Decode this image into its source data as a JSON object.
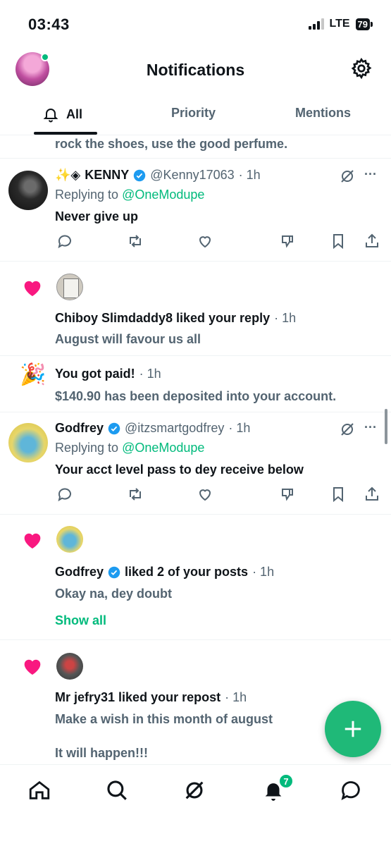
{
  "status_bar": {
    "time": "03:43",
    "network": "LTE",
    "battery": "79"
  },
  "header": {
    "title": "Notifications"
  },
  "tabs": [
    {
      "label": "All"
    },
    {
      "label": "Priority"
    },
    {
      "label": "Mentions"
    }
  ],
  "feed": {
    "truncated_text": "rock the shoes, use the good perfume.",
    "kenny": {
      "prefix": "✨◈",
      "name": "KENNY",
      "handle": "@Kenny17063",
      "time": "· 1h",
      "replying_label": "Replying to",
      "replying_handle": "@OneModupe",
      "text": "Never give up"
    },
    "chiboy": {
      "text": "Chiboy Slimdaddy8 liked your reply",
      "time": "· 1h",
      "quote": "August will favour us all"
    },
    "paid": {
      "title": "You got paid!",
      "time": "· 1h",
      "text": "$140.90 has been deposited into your account."
    },
    "godfrey_reply": {
      "name": "Godfrey",
      "handle": "@itzsmartgodfrey",
      "time": "· 1h",
      "replying_label": "Replying to",
      "replying_handle": "@OneModupe",
      "text": "Your acct level pass to dey receive below"
    },
    "godfrey_like": {
      "name": "Godfrey",
      "action": "liked 2 of your posts",
      "time": "· 1h",
      "quote": "Okay na, dey doubt",
      "show_all": "Show all"
    },
    "jefry": {
      "text": "Mr jefry31 liked your repost",
      "time": "· 1h",
      "quote_line1": "Make a wish in this month of august",
      "quote_line2": "It will happen!!!"
    }
  },
  "bottom_nav": {
    "notifications_badge": "7"
  },
  "colors": {
    "accent": "#00ba7c",
    "heart": "#f91880",
    "verified": "#1d9bf0",
    "text": "#0f1419",
    "muted": "#536471"
  }
}
